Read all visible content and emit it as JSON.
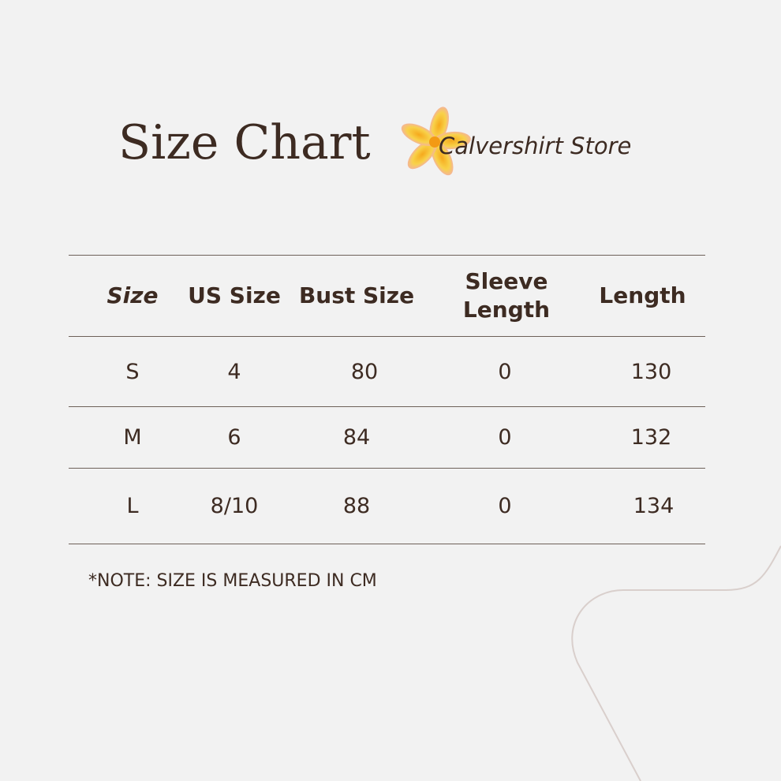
{
  "header": {
    "title": "Size Chart",
    "store_name": "Calvershirt Store"
  },
  "table": {
    "columns": [
      "Size",
      "US Size",
      "Bust Size",
      "Sleeve Length",
      "Length"
    ],
    "rows": [
      [
        "S",
        "4",
        "80",
        "0",
        "130"
      ],
      [
        "M",
        "6",
        "84",
        "0",
        "132"
      ],
      [
        "L",
        "8/10",
        "88",
        "0",
        "134"
      ]
    ]
  },
  "note": "*NOTE: SIZE IS MEASURED IN CM",
  "colors": {
    "background": "#f2f2f2",
    "text": "#3d2b22",
    "rule": "#6e6159",
    "flower_yellow": "#f7c531",
    "flower_pink": "#ee93b4"
  },
  "icons": {
    "logo": "frangipani-flower-icon"
  }
}
